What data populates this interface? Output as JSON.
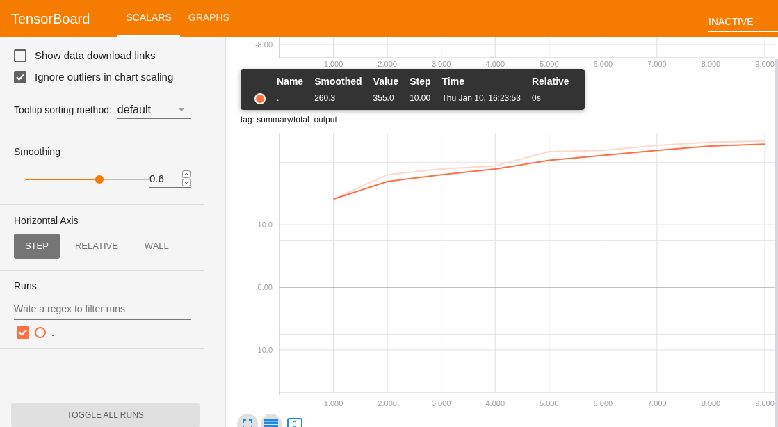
{
  "header": {
    "title": "TensorBoard",
    "tabs": [
      {
        "label": "SCALARS",
        "selected": true
      },
      {
        "label": "GRAPHS",
        "selected": false
      }
    ],
    "status_select": "INACTIVE"
  },
  "sidebar": {
    "options": [
      {
        "label": "Show data download links",
        "checked": false
      },
      {
        "label": "Ignore outliers in chart scaling",
        "checked": true
      }
    ],
    "tooltip_sorting": {
      "label": "Tooltip sorting method:",
      "value": "default"
    },
    "smoothing": {
      "title": "Smoothing",
      "level": 0.6,
      "value": "0.6"
    },
    "horizontal_axis": {
      "title": "Horizontal Axis",
      "options": [
        {
          "label": "STEP",
          "selected": true
        },
        {
          "label": "RELATIVE",
          "selected": false
        },
        {
          "label": "WALL",
          "selected": false
        }
      ]
    },
    "runs": {
      "title": "Runs",
      "placeholder": "Write a regex to filter runs",
      "items": [
        {
          "name": ".",
          "checked": true,
          "color": "#ff7043"
        }
      ]
    },
    "toggle_button": "TOGGLE ALL RUNS"
  },
  "previous_chart": {
    "ytick_label": "-8.00",
    "xtick_labels": [
      "1.000",
      "2.000",
      "3.000",
      "4.000",
      "5.000",
      "6.000",
      "7.000",
      "8.000",
      "9.000"
    ]
  },
  "chart": {
    "tag": "tag: summary/total_output",
    "chart_data": {
      "type": "line",
      "x": [
        1,
        2,
        3,
        4,
        5,
        6,
        7,
        8,
        9
      ],
      "xlim": [
        0,
        9.18
      ],
      "grid": true,
      "ylim": [
        -16.8,
        24.7
      ],
      "xticks": [
        {
          "value": 1,
          "label": "1.000"
        },
        {
          "value": 2,
          "label": "2.000"
        },
        {
          "value": 3,
          "label": "3.000"
        },
        {
          "value": 4,
          "label": "4.000"
        },
        {
          "value": 5,
          "label": "5.000"
        },
        {
          "value": 6,
          "label": "6.000"
        },
        {
          "value": 7,
          "label": "7.000"
        },
        {
          "value": 8,
          "label": "8.000"
        },
        {
          "value": 9,
          "label": "9.000"
        }
      ],
      "yticks": [
        {
          "value": 10,
          "label": "10.0"
        },
        {
          "value": 0,
          "label": "0.00"
        },
        {
          "value": -10,
          "label": "-10.0"
        }
      ],
      "series": [
        {
          "color": "#ffd8cc",
          "values": [
            14.1,
            18,
            18.9,
            19.4,
            21.7,
            21.9,
            22.7,
            23.2,
            23.4
          ]
        },
        {
          "color": "#ff7043",
          "values": [
            14.1,
            16.9,
            18,
            18.9,
            20.3,
            21.1,
            21.9,
            22.6,
            22.9
          ]
        }
      ]
    }
  },
  "tooltip": {
    "columns": [
      "Name",
      "Smoothed",
      "Value",
      "Step",
      "Time",
      "Relative"
    ],
    "row": {
      "color": "#ff7043",
      "cells": [
        ".",
        "260.3",
        "355.0",
        "10.00",
        "Thu Jan 10, 16:23:53",
        "0s"
      ]
    }
  }
}
